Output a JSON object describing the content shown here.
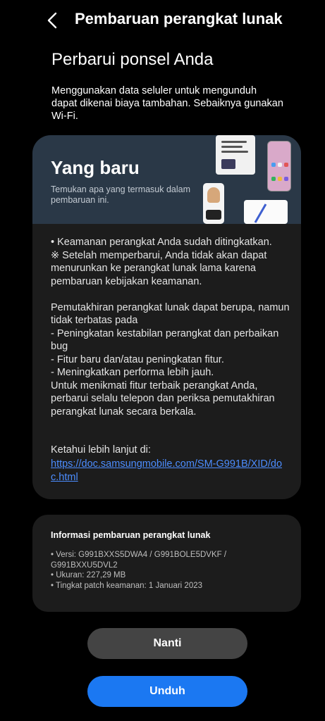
{
  "header": {
    "title": "Pembaruan perangkat lunak"
  },
  "page": {
    "title": "Perbarui ponsel Anda",
    "notice": "Menggunakan data seluler untuk mengunduh dapat dikenai biaya tambahan. Sebaiknya gunakan Wi-Fi."
  },
  "card": {
    "title": "Yang baru",
    "subtitle": "Temukan apa yang termasuk dalam pembaruan ini.",
    "body": "• Keamanan perangkat Anda sudah ditingkatkan.\n※ Setelah memperbarui, Anda tidak akan dapat menurunkan ke perangkat lunak lama karena pembaruan kebijakan keamanan.\n\nPemutakhiran perangkat lunak dapat berupa, namun tidak terbatas pada\n - Peningkatan kestabilan perangkat dan perbaikan bug\n - Fitur baru dan/atau peningkatan fitur.\n - Meningkatkan performa lebih jauh.\nUntuk menikmati fitur terbaik perangkat Anda, perbarui selalu telepon dan periksa pemutakhiran perangkat lunak secara berkala.",
    "learn_more_label": "Ketahui lebih lanjut di:",
    "link": "https://doc.samsungmobile.com/SM-G991B/XID/doc.html"
  },
  "info": {
    "title": "Informasi pembaruan perangkat lunak",
    "version": "• Versi: G991BXXS5DWA4 / G991BOLE5DVKF / G991BXXU5DVL2",
    "size": "• Ukuran: 227,29 MB",
    "patch": "• Tingkat patch keamanan: 1 Januari 2023"
  },
  "buttons": {
    "later": "Nanti",
    "download": "Unduh"
  },
  "colors": {
    "accent": "#1b78f2",
    "link": "#4c8dff",
    "banner": "#2a3847",
    "card": "#1c1c1c"
  },
  "icons": {
    "back": "back-arrow-icon"
  }
}
